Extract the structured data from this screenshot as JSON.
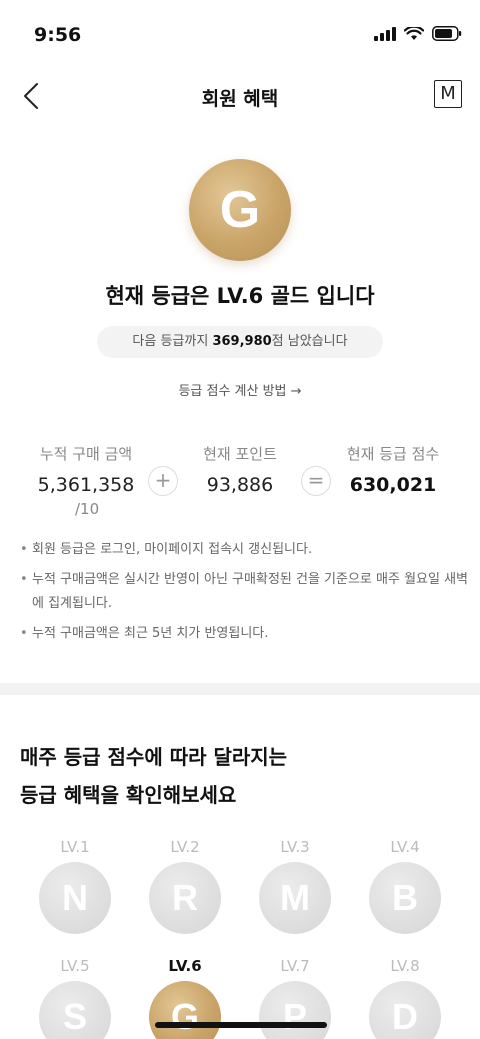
{
  "status": {
    "time": "9:56"
  },
  "nav": {
    "title": "회원 혜택",
    "m_label": "M"
  },
  "grade": {
    "letter": "G",
    "headline": "현재 등급은 LV.6 골드 입니다",
    "next_prefix": "다음 등급까지 ",
    "next_points": "369,980",
    "next_suffix": "점 남았습니다",
    "calc_link": "등급 점수 계산 방법 →"
  },
  "scores": {
    "purchase_label": "누적 구매 금액",
    "purchase_value": "5,361,358",
    "purchase_sub": "/10",
    "plus": "+",
    "point_label": "현재 포인트",
    "point_value": "93,886",
    "equals": "=",
    "grade_label": "현재 등급 점수",
    "grade_value": "630,021"
  },
  "notes": [
    "회원 등급은 로그인, 마이페이지 접속시 갱신됩니다.",
    "누적 구매금액은 실시간 반영이 아닌 구매확정된 건을 기준으로 매주 월요일 새벽에 집계됩니다.",
    "누적 구매금액은 최근 5년 치가 반영됩니다."
  ],
  "benefits": {
    "title_line1": "매주 등급 점수에 따라 달라지는",
    "title_line2": "등급 혜택을 확인해보세요"
  },
  "levels": [
    {
      "label": "LV.1",
      "letter": "N"
    },
    {
      "label": "LV.2",
      "letter": "R"
    },
    {
      "label": "LV.3",
      "letter": "M"
    },
    {
      "label": "LV.4",
      "letter": "B"
    },
    {
      "label": "LV.5",
      "letter": "S"
    },
    {
      "label": "LV.6",
      "letter": "G"
    },
    {
      "label": "LV.7",
      "letter": "P"
    },
    {
      "label": "LV.8",
      "letter": "D"
    }
  ],
  "colors": {
    "gold": "#c9a468",
    "inactive": "#dcdcdc"
  }
}
